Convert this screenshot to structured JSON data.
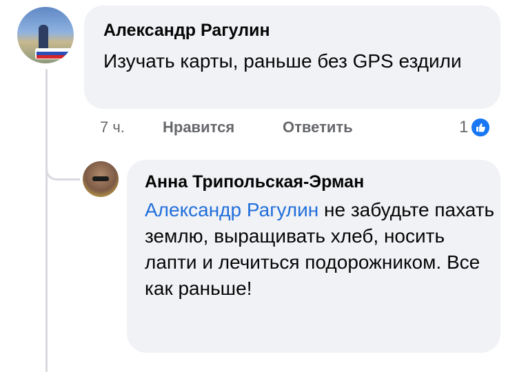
{
  "comment": {
    "author": "Александр Рагулин",
    "text": "Изучать карты, раньше без GPS ездили",
    "time": "7 ч.",
    "like_label": "Нравится",
    "reply_label": "Ответить",
    "reaction_count": "1",
    "reaction_icon": "like-icon",
    "avatar_icon": "user-avatar"
  },
  "reply": {
    "author": "Анна Трипольская-Эрман",
    "mention": "Александр Рагулин",
    "text": " не забудьте пахать землю, выращивать хлеб, носить лапти и лечиться подорожником. Все как раньше!",
    "avatar_icon": "user-avatar"
  },
  "colors": {
    "bubble": "#f0f2f5",
    "mention": "#216fdb",
    "meta": "#65676b",
    "like": "#1877f2"
  }
}
